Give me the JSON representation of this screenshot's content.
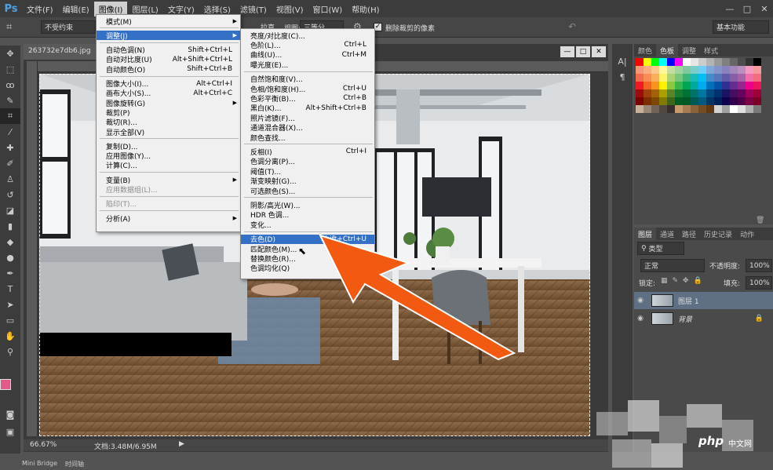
{
  "app": {
    "logo": "Ps"
  },
  "menubar": {
    "items": [
      "文件(F)",
      "编辑(E)",
      "图像(I)",
      "图层(L)",
      "文字(Y)",
      "选择(S)",
      "滤镜(T)",
      "视图(V)",
      "窗口(W)",
      "帮助(H)"
    ]
  },
  "window": {
    "minimize": "—",
    "maximize": "□",
    "close": "✕"
  },
  "options": {
    "ratio": "不受约束",
    "straighten": "拉直",
    "view_label": "视图:",
    "view_value": "三等分",
    "delete_cropped": "删除裁剪的像素",
    "workspace": "基本功能"
  },
  "document": {
    "tab": "263732e7db6.jpg",
    "zoom": "66.67%",
    "doc_size": "文档:3.48M/6.95M"
  },
  "bottom_tabs": [
    "Mini Bridge",
    "时间轴"
  ],
  "image_menu": {
    "items": [
      {
        "label": "模式(M)",
        "shortcut": "",
        "submenu": true
      },
      {
        "label": "调整(J)",
        "shortcut": "",
        "submenu": true,
        "highlight": true
      },
      {
        "label": "自动色调(N)",
        "shortcut": "Shift+Ctrl+L"
      },
      {
        "label": "自动对比度(U)",
        "shortcut": "Alt+Shift+Ctrl+L"
      },
      {
        "label": "自动颜色(O)",
        "shortcut": "Shift+Ctrl+B"
      },
      {
        "label": "图像大小(I)...",
        "shortcut": "Alt+Ctrl+I"
      },
      {
        "label": "画布大小(S)...",
        "shortcut": "Alt+Ctrl+C"
      },
      {
        "label": "图像旋转(G)",
        "shortcut": "",
        "submenu": true
      },
      {
        "label": "裁剪(P)",
        "shortcut": ""
      },
      {
        "label": "裁切(R)...",
        "shortcut": ""
      },
      {
        "label": "显示全部(V)",
        "shortcut": ""
      },
      {
        "label": "复制(D)...",
        "shortcut": ""
      },
      {
        "label": "应用图像(Y)...",
        "shortcut": ""
      },
      {
        "label": "计算(C)...",
        "shortcut": ""
      },
      {
        "label": "变量(B)",
        "shortcut": "",
        "submenu": true
      },
      {
        "label": "应用数据组(L)...",
        "shortcut": "",
        "disabled": true
      },
      {
        "label": "陷印(T)...",
        "shortcut": "",
        "disabled": true
      },
      {
        "label": "分析(A)",
        "shortcut": "",
        "submenu": true
      }
    ]
  },
  "adjust_menu": {
    "items": [
      {
        "label": "亮度/对比度(C)...",
        "shortcut": ""
      },
      {
        "label": "色阶(L)...",
        "shortcut": "Ctrl+L"
      },
      {
        "label": "曲线(U)...",
        "shortcut": "Ctrl+M"
      },
      {
        "label": "曝光度(E)...",
        "shortcut": ""
      },
      {
        "label": "自然饱和度(V)...",
        "shortcut": ""
      },
      {
        "label": "色相/饱和度(H)...",
        "shortcut": "Ctrl+U"
      },
      {
        "label": "色彩平衡(B)...",
        "shortcut": "Ctrl+B"
      },
      {
        "label": "黑白(K)...",
        "shortcut": "Alt+Shift+Ctrl+B"
      },
      {
        "label": "照片滤镜(F)...",
        "shortcut": ""
      },
      {
        "label": "通道混合器(X)...",
        "shortcut": ""
      },
      {
        "label": "颜色查找...",
        "shortcut": ""
      },
      {
        "label": "反相(I)",
        "shortcut": "Ctrl+I"
      },
      {
        "label": "色调分离(P)...",
        "shortcut": ""
      },
      {
        "label": "阈值(T)...",
        "shortcut": ""
      },
      {
        "label": "渐变映射(G)...",
        "shortcut": ""
      },
      {
        "label": "可选颜色(S)...",
        "shortcut": ""
      },
      {
        "label": "阴影/高光(W)...",
        "shortcut": ""
      },
      {
        "label": "HDR 色调...",
        "shortcut": ""
      },
      {
        "label": "变化...",
        "shortcut": ""
      },
      {
        "label": "去色(D)",
        "shortcut": "Shift+Ctrl+U",
        "highlight": true
      },
      {
        "label": "匹配颜色(M)...",
        "shortcut": ""
      },
      {
        "label": "替换颜色(R)...",
        "shortcut": ""
      },
      {
        "label": "色调均化(Q)",
        "shortcut": ""
      }
    ]
  },
  "swatch_panel": {
    "tabs": [
      "颜色",
      "色板",
      "调整",
      "样式"
    ]
  },
  "layers_panel": {
    "tabs": [
      "图层",
      "通道",
      "路径",
      "历史记录",
      "动作"
    ],
    "filter": "类型",
    "blend_mode": "正常",
    "opacity_label": "不透明度:",
    "opacity": "100%",
    "lock_label": "锁定:",
    "fill_label": "填充:",
    "fill": "100%",
    "layers": [
      {
        "name": "图层 1"
      },
      {
        "name": "背景"
      }
    ]
  },
  "watermark": {
    "text": "php",
    "sub": "中文网"
  },
  "colors": {
    "highlight": "#3370c6",
    "arrow": "#f25a12"
  }
}
